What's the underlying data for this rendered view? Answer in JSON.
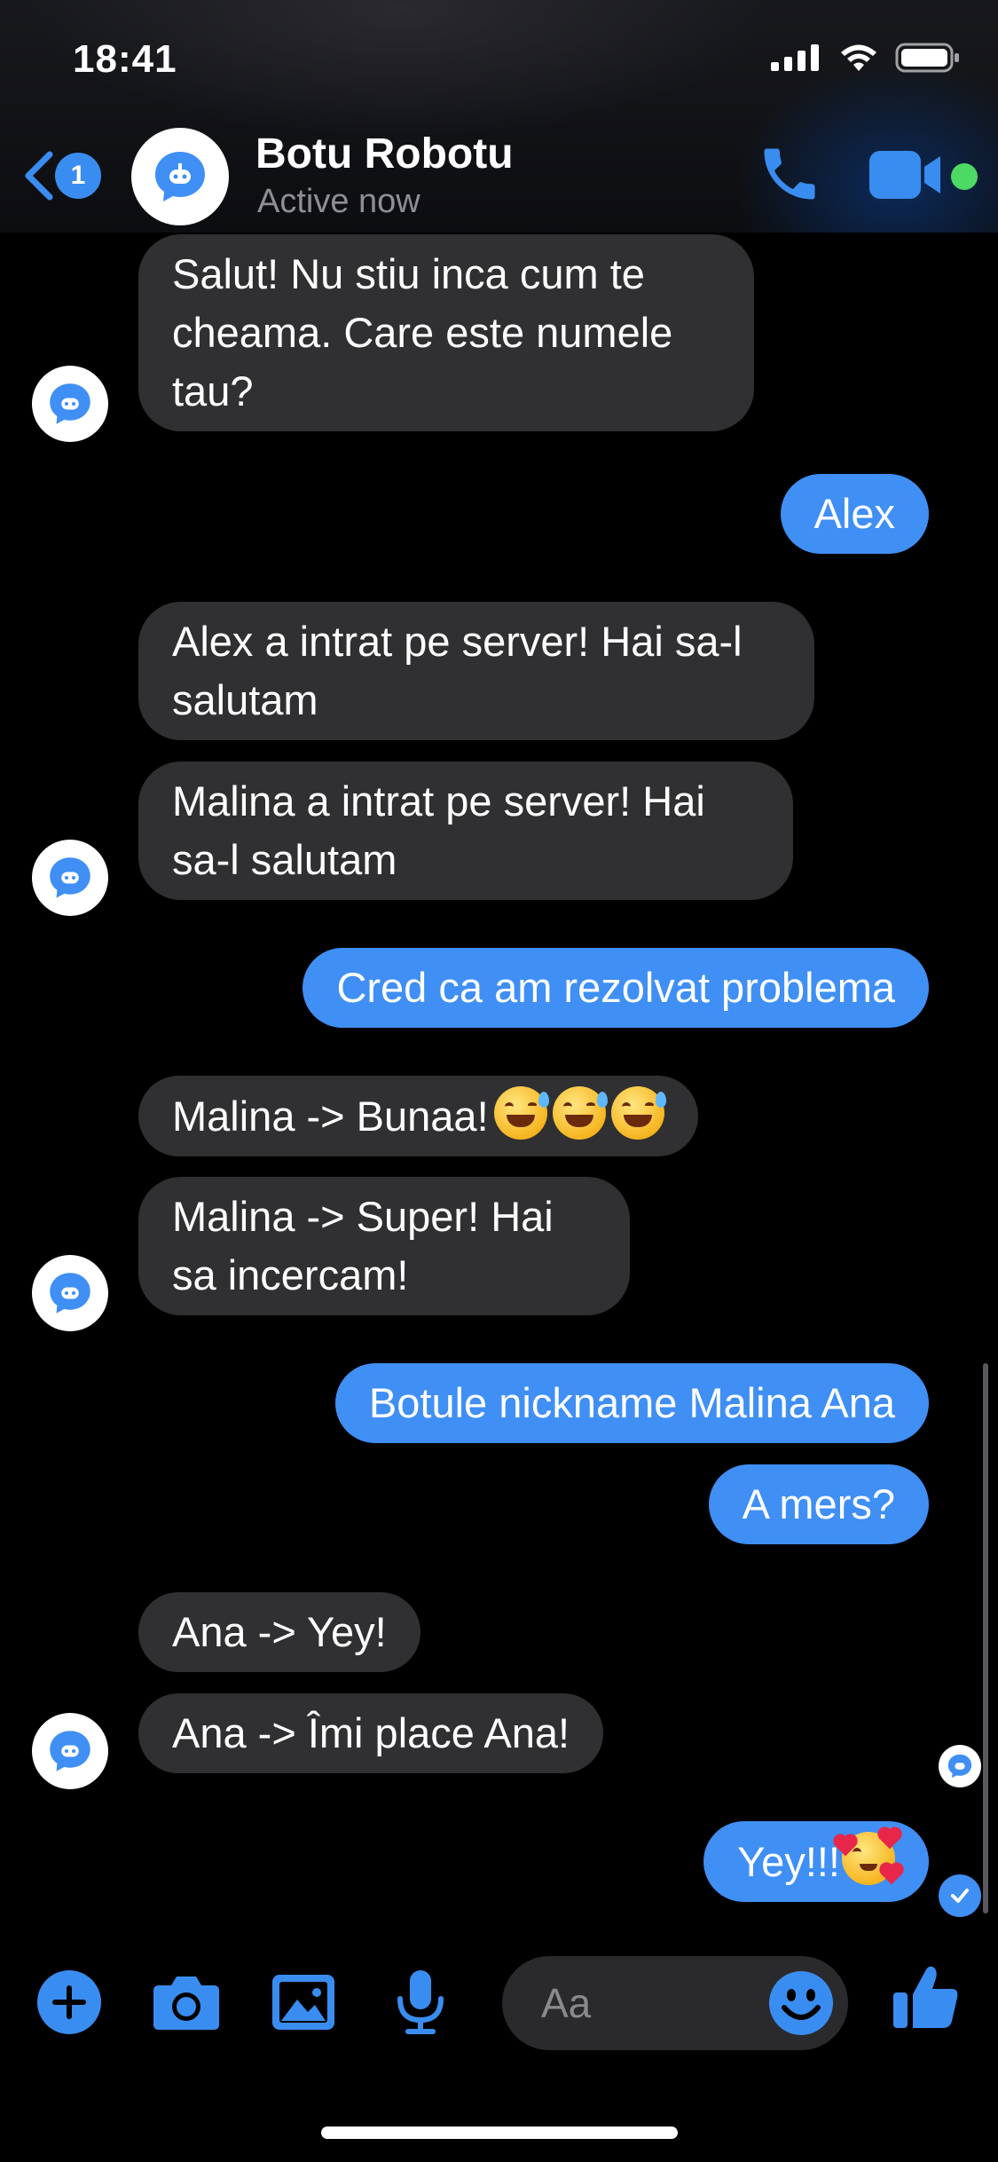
{
  "status_bar": {
    "time": "18:41"
  },
  "header": {
    "back_badge": "1",
    "name": "Botu Robotu",
    "status": "Active now"
  },
  "messages": [
    {
      "side": "in",
      "text": "Salut! Nu stiu inca cum te cheama. Care este numele tau?"
    },
    {
      "side": "out",
      "text": "Alex"
    },
    {
      "side": "in",
      "text": "Alex a intrat pe server! Hai sa-l salutam"
    },
    {
      "side": "in",
      "text": "Malina a intrat pe server! Hai sa-l salutam"
    },
    {
      "side": "out",
      "text": "Cred ca am rezolvat problema"
    },
    {
      "side": "in",
      "text": "Malina -> Bunaa!"
    },
    {
      "side": "in",
      "text": "Malina -> Super! Hai sa incercam!"
    },
    {
      "side": "out",
      "text": "Botule nickname Malina Ana"
    },
    {
      "side": "out",
      "text": "A mers?"
    },
    {
      "side": "in",
      "text": "Ana -> Yey!"
    },
    {
      "side": "in",
      "text": "Ana -> Îmi place Ana!"
    },
    {
      "side": "out",
      "text": "Yey!!!"
    }
  ],
  "composer": {
    "placeholder": "Aa"
  },
  "colors": {
    "accent": "#3f8ff5",
    "incoming_bubble": "#303032",
    "online": "#4cd964"
  },
  "icons": [
    "plus-icon",
    "camera-icon",
    "image-icon",
    "microphone-icon",
    "emoji-icon",
    "thumbs-up-icon",
    "phone-icon",
    "video-icon",
    "back-chevron-icon"
  ]
}
